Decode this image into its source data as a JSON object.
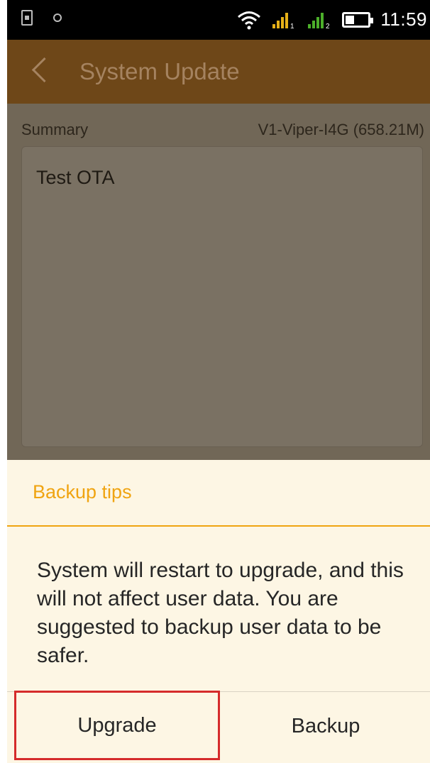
{
  "status_bar": {
    "time": "11:59",
    "icons": [
      "image-notification-icon",
      "brightness-icon",
      "wifi-icon",
      "signal-sim1-icon",
      "signal-sim2-icon",
      "battery-icon"
    ]
  },
  "app_bar": {
    "title": "System Update",
    "back_icon": "chevron-left-icon"
  },
  "summary": {
    "label": "Summary",
    "version": "V1-Viper-I4G (658.21M)",
    "text": "Test OTA"
  },
  "dialog": {
    "title": "Backup tips",
    "message": "System will restart to upgrade, and this will not affect user data. You are suggested to backup user data to be safer.",
    "buttons": {
      "upgrade": "Upgrade",
      "backup": "Backup"
    }
  },
  "colors": {
    "app_bar": "#6e4718",
    "accent": "#f0a411",
    "dialog_bg": "#fdf6e4",
    "highlight": "#d52b2b"
  }
}
